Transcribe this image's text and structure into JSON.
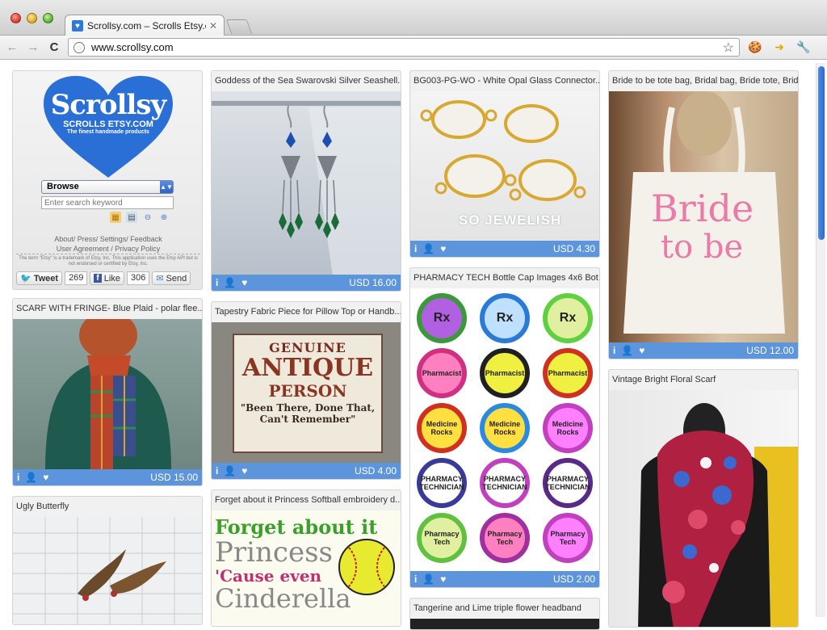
{
  "browser": {
    "tab_title": "Scrollsy.com – Scrolls Etsy.co",
    "url": "www.scrollsy.com"
  },
  "logo": {
    "main": "Scrollsy",
    "sub": "SCROLLS ETSY.COM",
    "tagline": "The finest handmade products"
  },
  "sidebar": {
    "browse_value": "Browse",
    "search_placeholder": "Enter search keyword",
    "links_line1": "About/ Press/ Settings/ Feedback",
    "links_line2": "User Agreement / Privacy Policy",
    "disclaimer": "The term \"Etsy\" is a trademark of Etsy, Inc. This application uses the Etsy API but is not endorsed or certified by Etsy, Inc.",
    "tweet_label": "Tweet",
    "tweet_count": "269",
    "like_label": "Like",
    "like_count": "306",
    "send_label": "Send"
  },
  "cards": {
    "c1": {
      "title": "SCARF WITH FRINGE- Blue Plaid - polar flee...",
      "price": "USD 15.00"
    },
    "c2": {
      "title": "Ugly Butterfly"
    },
    "c3": {
      "title": "Goddess of the Sea Swarovski Silver Seashell...",
      "price": "USD 16.00"
    },
    "c4": {
      "title": "Tapestry Fabric Piece for Pillow Top or Handb...",
      "price": "USD 4.00",
      "line1": "GENUINE",
      "line2": "ANTIQUE",
      "line3": "PERSON",
      "line4": "\"Been There, Done That,",
      "line5": "Can't Remember\""
    },
    "c5": {
      "title": "Forget about it Princess Softball embroidery d...",
      "line1": "Forget about it",
      "line2": "Princess",
      "line3": "'Cause even",
      "line4": "Cinderella"
    },
    "c6": {
      "title": "BG003-PG-WO - White Opal Glass Connector...",
      "price": "USD 4.30",
      "watermark": "SO JEWELISH"
    },
    "c7": {
      "title": "PHARMACY TECH Bottle Cap Images 4x6 Bot...",
      "price": "USD 2.00"
    },
    "c8": {
      "title": "Tangerine and Lime triple flower headband"
    },
    "c9": {
      "title": "Bride to be tote bag, Bridal bag, Bride tote, Brid...",
      "price": "USD 12.00",
      "bag_line1": "Bride",
      "bag_line2": "to be"
    },
    "c10": {
      "title": "Vintage Bright Floral Scarf"
    }
  },
  "bottle_caps": [
    "Rx",
    "Rx",
    "Rx",
    "Pharmacist",
    "Pharmacist",
    "Pharmacist",
    "Medicine Rocks",
    "Medicine Rocks",
    "Medicine Rocks",
    "PHARMACY TECHNICIAN",
    "PHARMACY TECHNICIAN",
    "PHARMACY TECHNICIAN",
    "Pharmacy Tech",
    "Pharmacy Tech",
    "Pharmacy Tech"
  ],
  "colors": {
    "accent": "#5d95dd",
    "logo_blue": "#2a6fd6"
  }
}
